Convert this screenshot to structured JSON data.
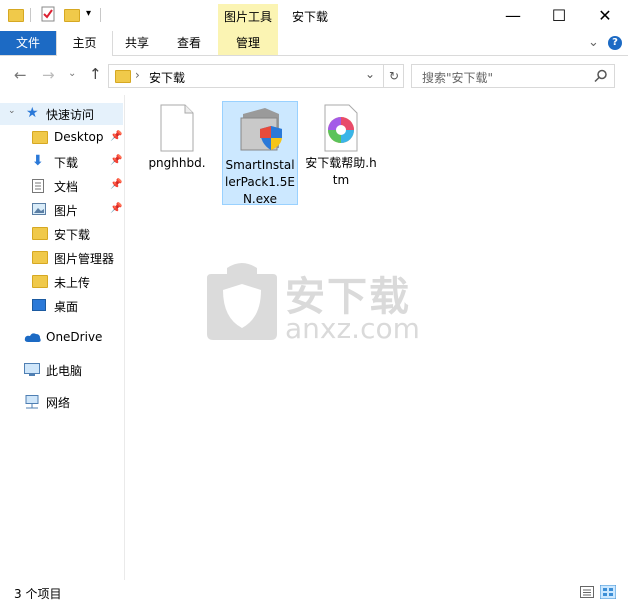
{
  "titlebar": {
    "context_tab": "图片工具",
    "title": "安下载",
    "minimize": "—",
    "maximize": "☐",
    "close": "✕"
  },
  "ribbon": {
    "tabs": [
      "文件",
      "主页",
      "共享",
      "查看",
      "管理"
    ],
    "expand": "⌄",
    "help": "?"
  },
  "address": {
    "path": "安下载",
    "search_placeholder": "搜索\"安下载\""
  },
  "sidebar": {
    "quick_access": "快速访问",
    "items": [
      {
        "label": "Desktop",
        "pinned": true
      },
      {
        "label": "下载",
        "pinned": true
      },
      {
        "label": "文档",
        "pinned": true
      },
      {
        "label": "图片",
        "pinned": true
      },
      {
        "label": "安下载",
        "pinned": false
      },
      {
        "label": "图片管理器",
        "pinned": false
      },
      {
        "label": "未上传",
        "pinned": false
      },
      {
        "label": "桌面",
        "pinned": false
      }
    ],
    "onedrive": "OneDrive",
    "this_pc": "此电脑",
    "network": "网络"
  },
  "files": [
    {
      "name": "pnghhbd.",
      "type": "blank"
    },
    {
      "name": "SmartInstallerPack1.5EN.exe",
      "type": "installer"
    },
    {
      "name": "安下载帮助.htm",
      "type": "htm"
    }
  ],
  "status": {
    "count": "3 个项目"
  },
  "watermark": {
    "text_cn": "安下载",
    "text_en": "anxz.com"
  },
  "colors": {
    "accent": "#1c6ac4",
    "context": "#fbf4b3",
    "selection": "#cce8ff"
  }
}
